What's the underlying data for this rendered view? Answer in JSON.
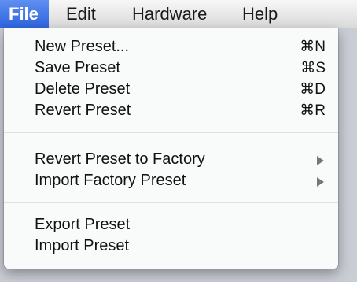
{
  "menubar": {
    "items": [
      {
        "label": "File",
        "active": true
      },
      {
        "label": "Edit",
        "active": false
      },
      {
        "label": "Hardware",
        "active": false
      },
      {
        "label": "Help",
        "active": false
      }
    ]
  },
  "file_menu": {
    "groups": [
      [
        {
          "label": "New Preset...",
          "shortcut": "⌘N"
        },
        {
          "label": "Save Preset",
          "shortcut": "⌘S"
        },
        {
          "label": "Delete Preset",
          "shortcut": "⌘D"
        },
        {
          "label": "Revert Preset",
          "shortcut": "⌘R"
        }
      ],
      [
        {
          "label": "Revert Preset to Factory",
          "submenu_icon": "submenu-arrow-icon"
        },
        {
          "label": "Import Factory Preset",
          "submenu_icon": "submenu-arrow-icon"
        }
      ],
      [
        {
          "label": "Export Preset"
        },
        {
          "label": "Import Preset"
        }
      ]
    ]
  },
  "colors": {
    "menubar_highlight": "#2d63df",
    "menu_background": "#fafafa",
    "text": "#111111",
    "separator": "#e0e0e0",
    "submenu_arrow": "#777777"
  }
}
